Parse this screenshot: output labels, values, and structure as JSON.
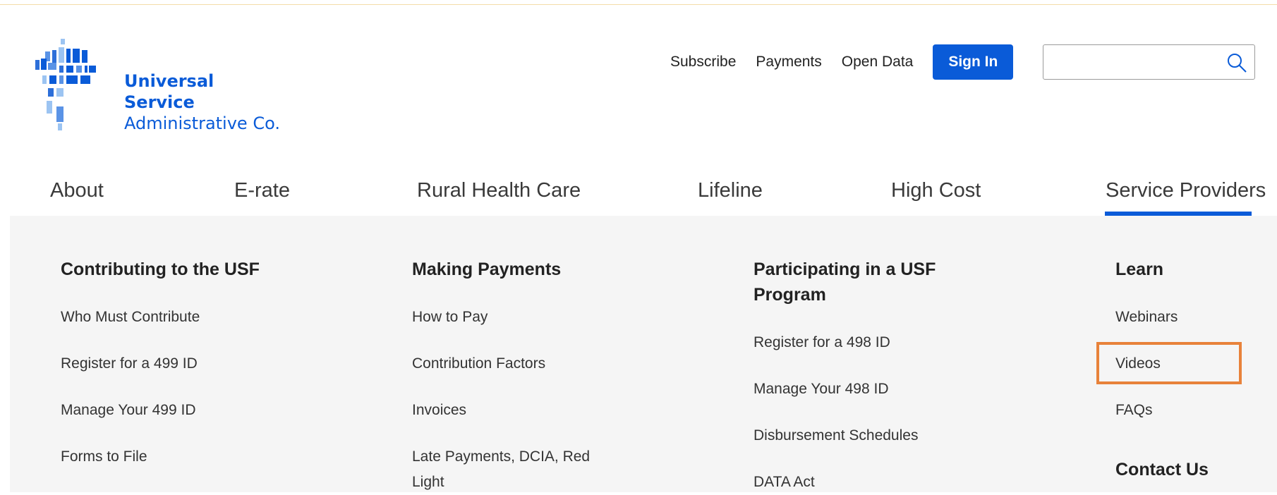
{
  "brand": {
    "name_line1": "Universal Service",
    "name_line2": "Administrative Co.",
    "color": "#0a5bd8"
  },
  "utility_nav": {
    "subscribe": "Subscribe",
    "payments": "Payments",
    "open_data": "Open Data",
    "sign_in": "Sign In"
  },
  "search": {
    "value": "",
    "placeholder": "",
    "icon": "search-icon"
  },
  "main_nav": {
    "items": [
      {
        "label": "About"
      },
      {
        "label": "E-rate"
      },
      {
        "label": "Rural Health Care"
      },
      {
        "label": "Lifeline"
      },
      {
        "label": "High Cost"
      },
      {
        "label": "Service Providers",
        "active": true
      }
    ]
  },
  "mega_menu": {
    "columns": [
      {
        "heading": "Contributing to the USF",
        "links": [
          "Who Must Contribute",
          "Register for a 499 ID",
          "Manage Your 499 ID",
          "Forms to File"
        ]
      },
      {
        "heading": "Making Payments",
        "links": [
          "How to Pay",
          "Contribution Factors",
          "Invoices",
          "Late Payments, DCIA, Red Light"
        ]
      },
      {
        "heading": "Participating in a USF Program",
        "links": [
          "Register for a 498 ID",
          "Manage Your 498 ID",
          "Disbursement Schedules",
          "DATA Act"
        ]
      },
      {
        "heading": "Learn",
        "links": [
          "Webinars",
          "Videos",
          "FAQs"
        ],
        "heading2": "Contact Us"
      }
    ]
  },
  "colors": {
    "accent": "#0a5bd8",
    "highlight": "#e8823a",
    "panel_bg": "#f5f5f5"
  }
}
